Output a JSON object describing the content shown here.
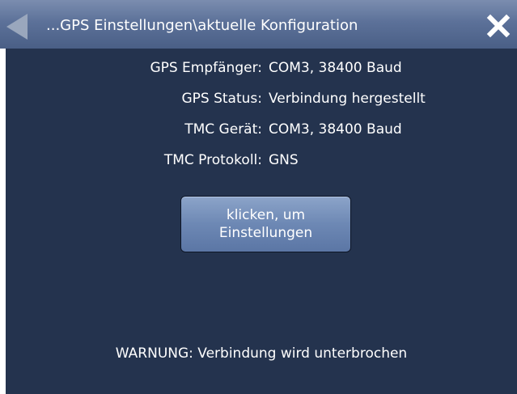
{
  "header": {
    "title": "...GPS Einstellungen\\aktuelle Konfiguration",
    "back_icon": "triangle-left-icon",
    "close_icon": "close-x-icon"
  },
  "config": {
    "rows": [
      {
        "label": "GPS Empfänger:",
        "value": "COM3, 38400 Baud"
      },
      {
        "label": "GPS Status:",
        "value": "Verbindung hergestellt"
      },
      {
        "label": "TMC Gerät:",
        "value": "COM3, 38400 Baud"
      },
      {
        "label": "TMC Protokoll:",
        "value": "GNS"
      }
    ]
  },
  "button": {
    "line1": "klicken, um",
    "line2": "Einstellungen"
  },
  "footer": {
    "warning": "WARNUNG: Verbindung wird unterbrochen"
  },
  "colors": {
    "background": "#24334e",
    "titlebar": "#5c7199",
    "button": "#6d88b4",
    "text": "#ffffff"
  }
}
